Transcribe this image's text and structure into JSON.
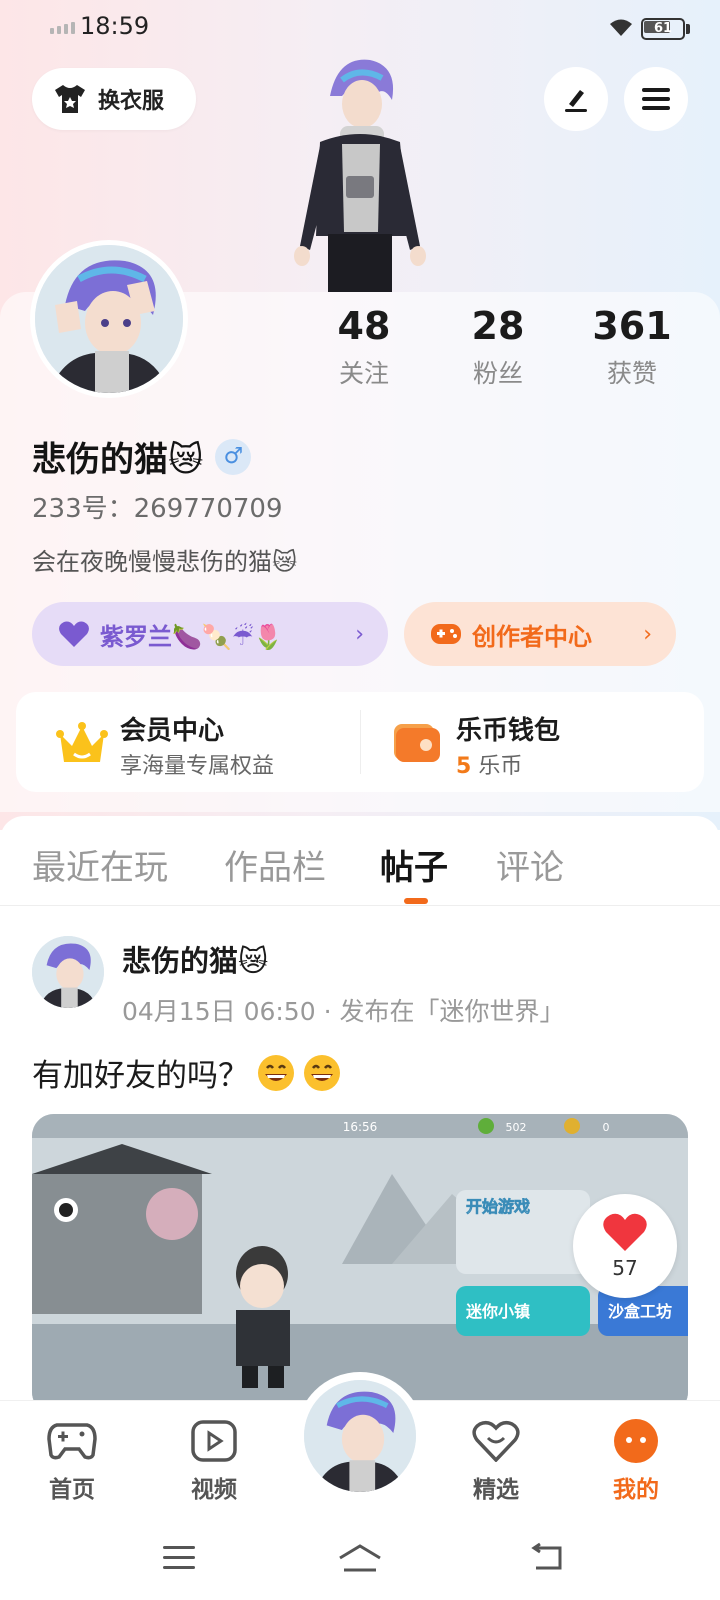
{
  "status_bar": {
    "time": "18:59",
    "battery": "61"
  },
  "header": {
    "outfit_button": "换衣服"
  },
  "profile": {
    "stats": [
      {
        "value": "48",
        "label": "关注"
      },
      {
        "value": "28",
        "label": "粉丝"
      },
      {
        "value": "361",
        "label": "获赞"
      }
    ],
    "username": "悲伤的猫😿",
    "gender": "♂",
    "uid": "233号：269770709",
    "bio": "会在夜晚慢慢悲伤的猫😿",
    "badge_pill": "紫罗兰🍆🍡☔🌷",
    "creator_pill": "创作者中心",
    "chevron": "›"
  },
  "member": {
    "vip_title": "会员中心",
    "vip_sub": "享海量专属权益",
    "wallet_title": "乐币钱包",
    "wallet_amount": "5",
    "wallet_unit": "乐币"
  },
  "tabs": [
    "最近在玩",
    "作品栏",
    "帖子",
    "评论"
  ],
  "active_tab": 2,
  "post": {
    "author": "悲伤的猫😿",
    "meta": "04月15日 06:50 · 发布在「迷你世界」",
    "text": "有加好友的吗？",
    "likes": "57",
    "image_overlay": {
      "time": "16:56",
      "coins_a": "502",
      "coins_b": "0",
      "start_game": "开始游戏",
      "mini_town": "迷你小镇",
      "sandbox": "沙盒工坊"
    }
  },
  "bottom_nav": [
    {
      "label": "首页",
      "icon": "gamepad-icon"
    },
    {
      "label": "视频",
      "icon": "video-play-icon"
    },
    {
      "label": "精选",
      "icon": "heart-smile-icon"
    },
    {
      "label": "我的",
      "icon": "profile-face-icon"
    }
  ],
  "colors": {
    "accent": "#f26a1b",
    "purple": "#7a5ad0",
    "badge_bg": "#e6dcf7",
    "creator_bg": "#fde3d5"
  }
}
